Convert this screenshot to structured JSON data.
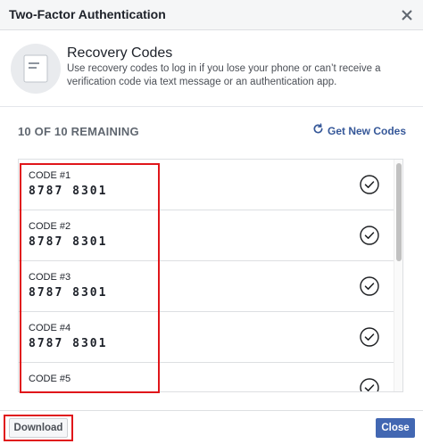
{
  "dialog": {
    "title": "Two-Factor Authentication"
  },
  "intro": {
    "heading": "Recovery Codes",
    "description": "Use recovery codes to log in if you lose your phone or can’t receive a verification code via text message or an authentication app."
  },
  "status": {
    "remaining": "10 OF 10 REMAINING",
    "get_new_codes": "Get New Codes"
  },
  "codes": [
    {
      "label": "CODE #1",
      "value": "8787 8301"
    },
    {
      "label": "CODE #2",
      "value": "8787 8301"
    },
    {
      "label": "CODE #3",
      "value": "8787 8301"
    },
    {
      "label": "CODE #4",
      "value": "8787 8301"
    },
    {
      "label": "CODE #5",
      "value": ""
    }
  ],
  "footer": {
    "download_label": "Download",
    "close_label": "Close"
  },
  "colors": {
    "primary": "#4267b2",
    "link": "#365899",
    "highlight": "#e0161a"
  },
  "icons": {
    "refresh": "refresh-icon",
    "document": "document-icon",
    "check": "check-circle-icon",
    "close": "close-icon"
  }
}
